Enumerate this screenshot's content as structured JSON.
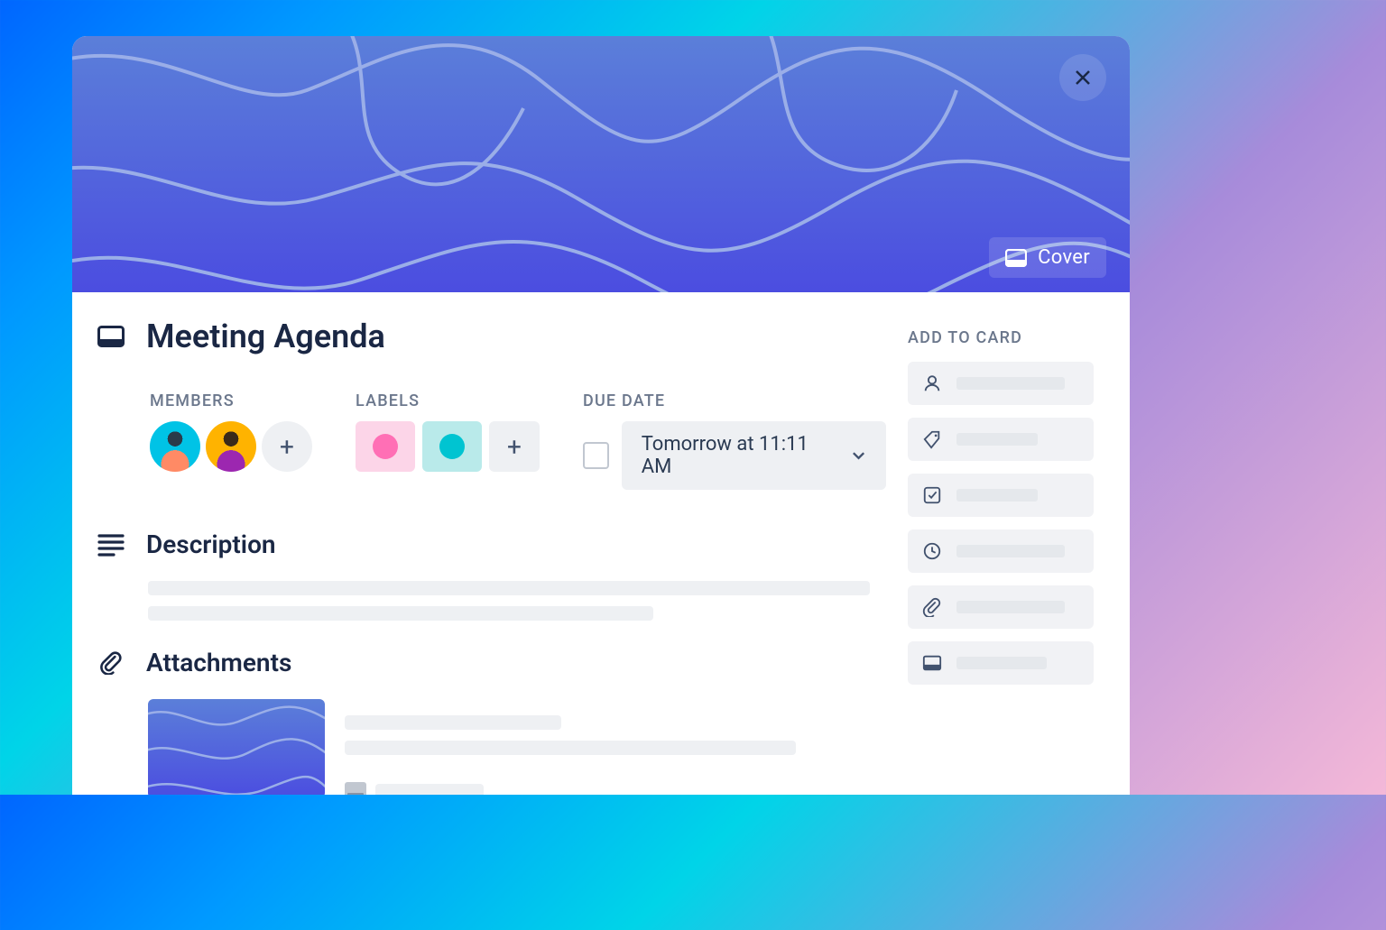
{
  "card": {
    "title": "Meeting Agenda",
    "cover_button": "Cover"
  },
  "meta": {
    "members_label": "MEMBERS",
    "labels_label": "LABELS",
    "due_date_label": "DUE DATE",
    "due_date_value": "Tomorrow at 11:11 AM",
    "label_colors": {
      "pink_bg": "#fcd5e8",
      "pink_dot": "#ff6fb5",
      "teal_bg": "#b9eaea",
      "teal_dot": "#00c4d1"
    }
  },
  "sections": {
    "description": "Description",
    "attachments": "Attachments"
  },
  "sidebar": {
    "title": "ADD TO CARD",
    "items": [
      "Members",
      "Labels",
      "Checklist",
      "Dates",
      "Attachment",
      "Cover"
    ]
  }
}
